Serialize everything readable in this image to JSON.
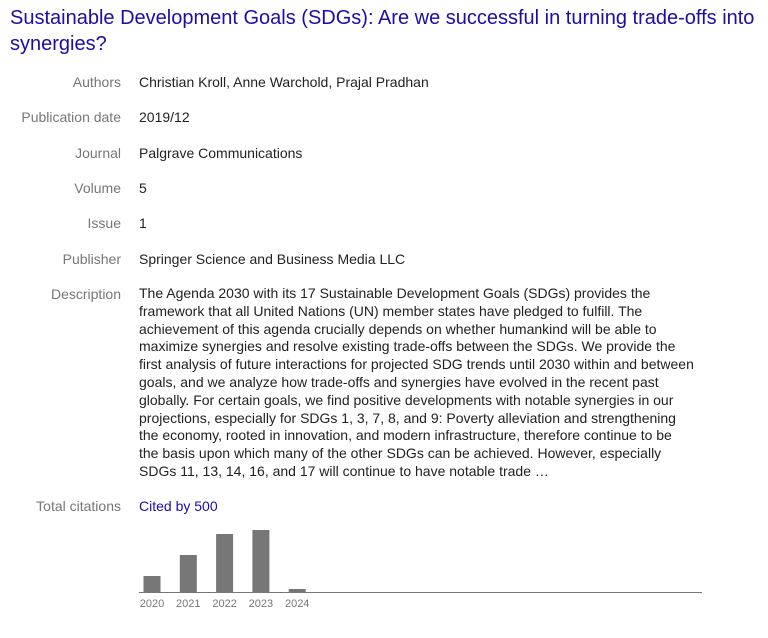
{
  "article": {
    "title": "Sustainable Development Goals (SDGs): Are we successful in turning trade-offs into synergies?"
  },
  "fields": {
    "authors": {
      "label": "Authors",
      "value": "Christian Kroll, Anne Warchold, Prajal Pradhan"
    },
    "publication_date": {
      "label": "Publication date",
      "value": "2019/12"
    },
    "journal": {
      "label": "Journal",
      "value": "Palgrave Communications"
    },
    "volume": {
      "label": "Volume",
      "value": "5"
    },
    "issue": {
      "label": "Issue",
      "value": "1"
    },
    "publisher": {
      "label": "Publisher",
      "value": "Springer Science and Business Media LLC"
    },
    "description": {
      "label": "Description",
      "value": "The Agenda 2030 with its 17 Sustainable Development Goals (SDGs) provides the framework that all United Nations (UN) member states have pledged to fulfill. The achievement of this agenda crucially depends on whether humankind will be able to maximize synergies and resolve existing trade-offs between the SDGs. We provide the first analysis of future interactions for projected SDG trends until 2030 within and between goals, and we analyze how trade-offs and synergies have evolved in the recent past globally. For certain goals, we find positive developments with notable synergies in our projections, especially for SDGs 1, 3, 7, 8, and 9: Poverty alleviation and strengthening the economy, rooted in innovation, and modern infrastructure, therefore continue to be the basis upon which many of the other SDGs can be achieved. However, especially SDGs 11, 13, 14, 16, and 17 will continue to have notable trade …"
    },
    "total_citations": {
      "label": "Total citations",
      "link_text": "Cited by 500"
    }
  },
  "colors": {
    "link": "#1a0dab",
    "label": "#777777",
    "bar": "#777777"
  },
  "chart_data": {
    "type": "bar",
    "categories": [
      "2020",
      "2021",
      "2022",
      "2023",
      "2024"
    ],
    "values": [
      16,
      37,
      58,
      62,
      3
    ],
    "ylim": [
      0,
      62
    ],
    "grid": false,
    "legend": "none"
  }
}
